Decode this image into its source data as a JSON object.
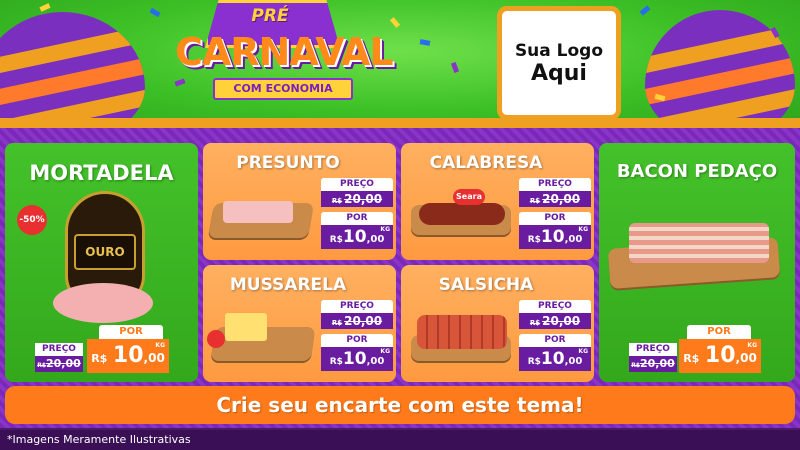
{
  "header": {
    "title_pre": "PRÉ",
    "title_main": "CARNAVAL",
    "title_ribbon": "COM ECONOMIA",
    "logo_line1": "Sua Logo",
    "logo_line2": "Aqui"
  },
  "products": {
    "mortadela": {
      "name": "MORTADELA",
      "discount": "-50%",
      "brand": "OURO",
      "preco_label": "PREÇO",
      "old_currency": "R$",
      "old_price": "20,00",
      "por_label": "POR",
      "currency": "R$",
      "price_int": "10",
      "price_dec": ",00",
      "unit": "KG"
    },
    "presunto": {
      "name": "PRESUNTO",
      "preco_label": "PREÇO",
      "old_currency": "R$",
      "old_price": "20,00",
      "por_label": "POR",
      "currency": "R$",
      "price_int": "10",
      "price_dec": ",00",
      "unit": "KG"
    },
    "calabresa": {
      "name": "CALABRESA",
      "brand": "Seara",
      "preco_label": "PREÇO",
      "old_currency": "R$",
      "old_price": "20,00",
      "por_label": "POR",
      "currency": "R$",
      "price_int": "10",
      "price_dec": ",00",
      "unit": "KG"
    },
    "bacon": {
      "name": "BACON PEDAÇO",
      "preco_label": "PREÇO",
      "old_currency": "R$",
      "old_price": "20,00",
      "por_label": "POR",
      "currency": "R$",
      "price_int": "10",
      "price_dec": ",00",
      "unit": "KG"
    },
    "mussarela": {
      "name": "MUSSARELA",
      "preco_label": "PREÇO",
      "old_currency": "R$",
      "old_price": "20,00",
      "por_label": "POR",
      "currency": "R$",
      "price_int": "10",
      "price_dec": ",00",
      "unit": "KG"
    },
    "salsicha": {
      "name": "SALSICHA",
      "preco_label": "PREÇO",
      "old_currency": "R$",
      "old_price": "20,00",
      "por_label": "POR",
      "currency": "R$",
      "price_int": "10",
      "price_dec": ",00",
      "unit": "KG"
    }
  },
  "cta": {
    "label": "Crie seu encarte com este tema!"
  },
  "footer": {
    "disclaimer": "*Imagens Meramente Ilustrativas"
  },
  "colors": {
    "green": "#3cc026",
    "purple": "#7a28b8",
    "orange": "#ff9a40",
    "accent_orange": "#ff7a1a",
    "dark_purple": "#6a1ca0",
    "gold": "#f0a020"
  }
}
